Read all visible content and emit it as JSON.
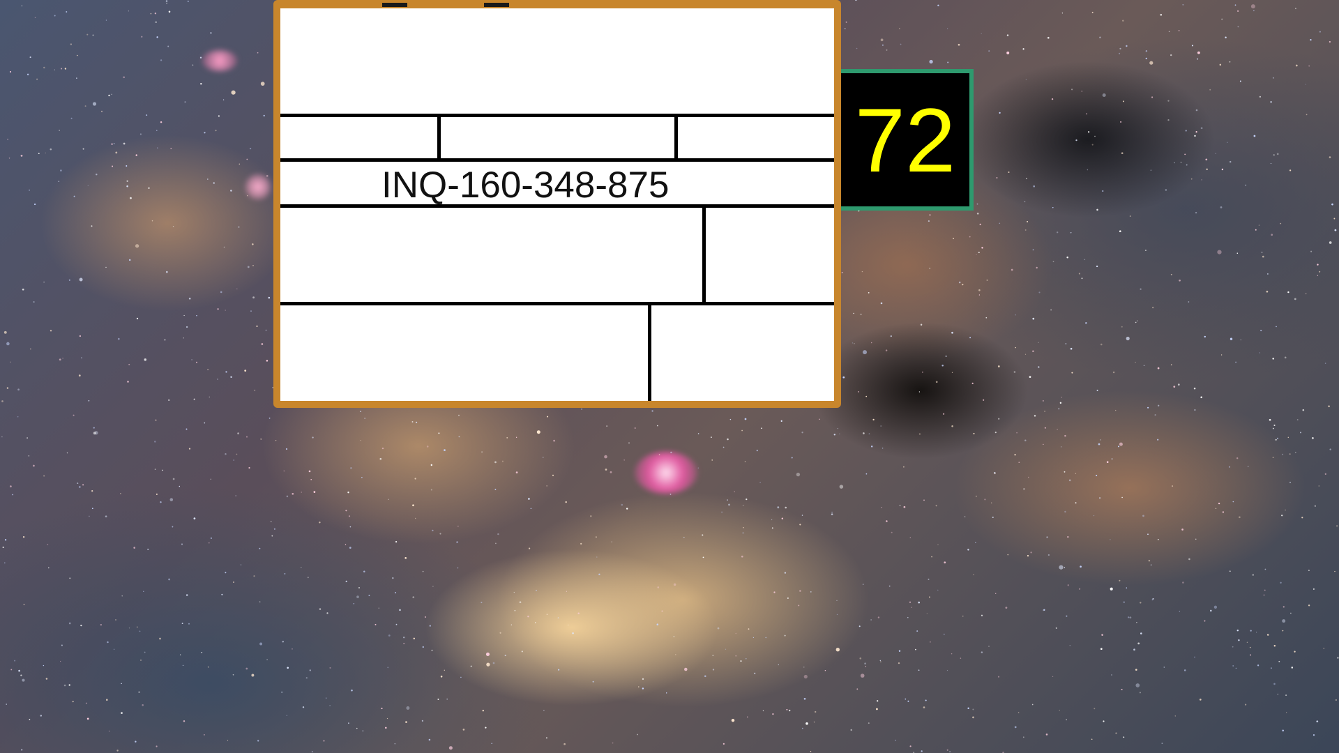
{
  "background": {
    "icon": "milky-way-wallpaper"
  },
  "form": {
    "reference_id": "INQ-160-348-875",
    "frame_color": "#c8862c"
  },
  "counter": {
    "value": "72",
    "text_color": "#ffff00",
    "border_color": "#2e9a6e"
  }
}
